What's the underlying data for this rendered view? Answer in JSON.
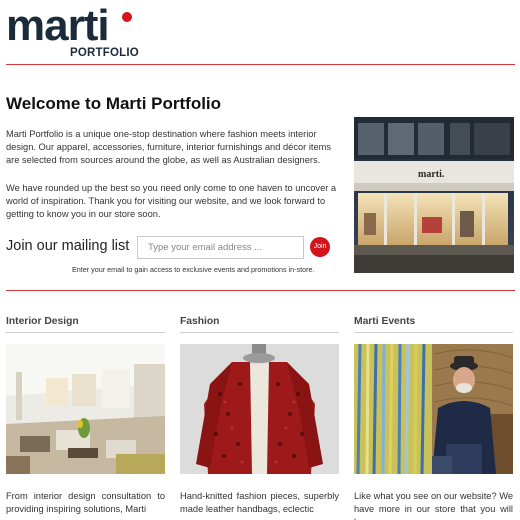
{
  "brand": {
    "name": "marti",
    "subtitle": "PORTFOLIO",
    "accent": "#d4141b",
    "navy": "#1c2b3a"
  },
  "welcome": {
    "title": "Welcome to Marti Portfolio",
    "paragraph1": "Marti Portfolio is a unique one-stop destination where fashion meets interior design. Our apparel, accessories, furniture, interior furnishings and décor items are selected from sources around the globe, as well as Australian designers.",
    "paragraph2": "We have rounded up the best so you need only come to one haven to uncover a world of inspiration. Thank you for visiting our website, and we look forward to getting to know you in our store soon."
  },
  "mailing": {
    "label": "Join our mailing list",
    "placeholder": "Type your email address ...",
    "button": "Join",
    "hint": "Enter your email to gain access to exclusive events and promotions in-store."
  },
  "columns": [
    {
      "title": "Interior Design",
      "text": "From interior design consultation to providing inspiring solutions, Marti"
    },
    {
      "title": "Fashion",
      "text": "Hand-knitted fashion pieces, superbly made leather handbags, eclectic"
    },
    {
      "title": "Marti Events",
      "text": "Like what you see on our website? We have more in our store that you will love."
    }
  ],
  "store_sign": "marti."
}
